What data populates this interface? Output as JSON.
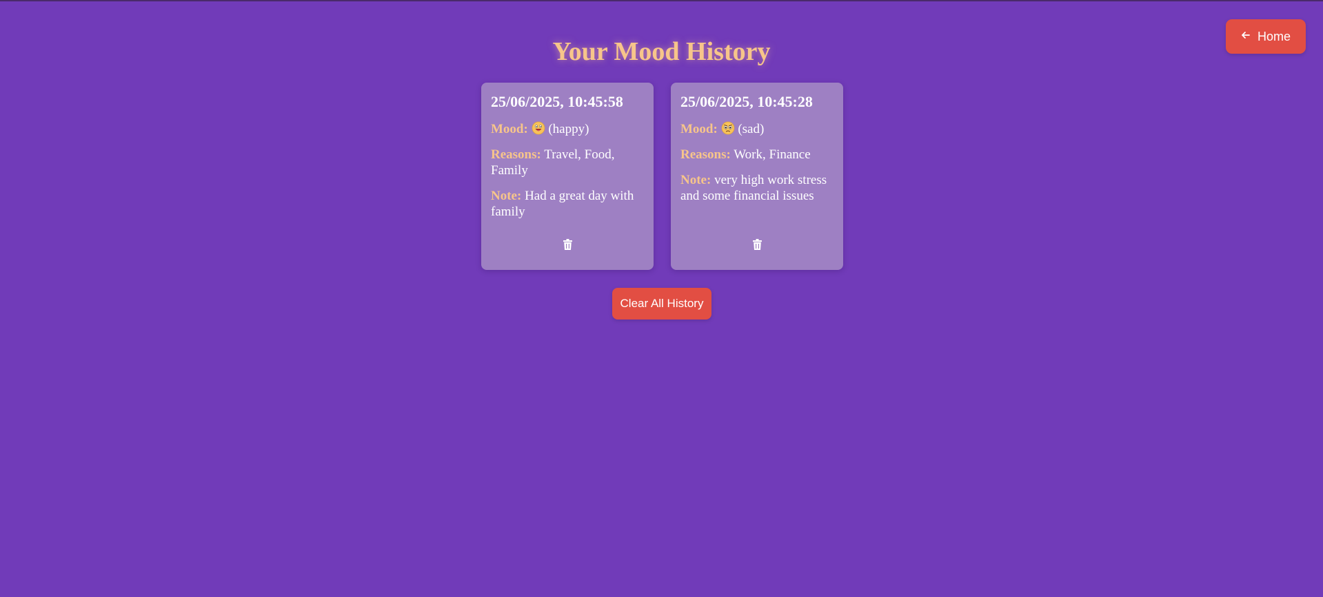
{
  "header": {
    "home_label": "Home",
    "home_icon": "arrow-left-icon",
    "title": "Your Mood History"
  },
  "labels": {
    "mood": "Mood:",
    "reasons": "Reasons:",
    "note": "Note:"
  },
  "entries": [
    {
      "date": "25/06/2025, 10:45:58",
      "mood_emoji": "happy-face-icon",
      "mood_text": "(happy)",
      "reasons": "Travel, Food, Family",
      "note": "Had a great day with family",
      "delete_icon": "trash-icon"
    },
    {
      "date": "25/06/2025, 10:45:28",
      "mood_emoji": "sad-face-icon",
      "mood_text": "(sad)",
      "reasons": "Work, Finance",
      "note": "very high work stress and some financial issues",
      "delete_icon": "trash-icon"
    }
  ],
  "actions": {
    "clear_label": "Clear All History"
  },
  "colors": {
    "background": "#713bb9",
    "accent": "#e24e43",
    "title": "#f7c58a",
    "card": "#9e80c3"
  }
}
